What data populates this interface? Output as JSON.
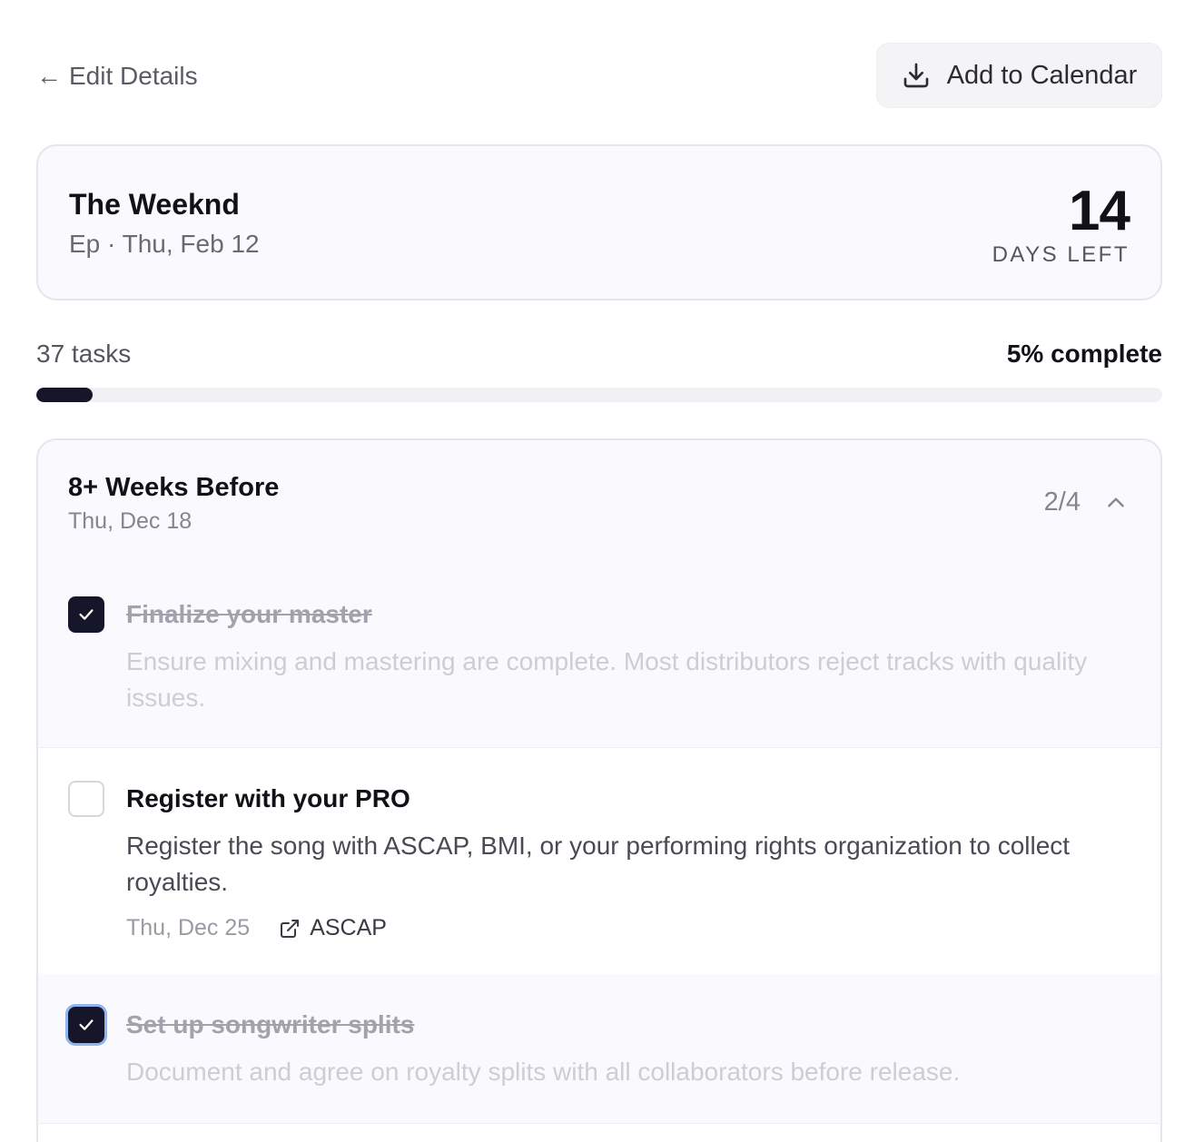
{
  "nav": {
    "back_label": "Edit Details",
    "calendar_button_label": "Add to Calendar"
  },
  "release": {
    "artist": "The Weeknd",
    "subtitle": "Ep · Thu, Feb 12",
    "days_left_value": "14",
    "days_left_label": "DAYS LEFT"
  },
  "progress": {
    "tasks_label": "37 tasks",
    "complete_label": "5% complete",
    "fraction": 0.05
  },
  "section": {
    "title": "8+ Weeks Before",
    "date": "Thu, Dec 18",
    "count": "2/4",
    "tasks": [
      {
        "title": "Finalize your master",
        "description": "Ensure mixing and mastering are complete. Most distributors reject tracks with quality issues.",
        "checked": true
      },
      {
        "title": "Register with your PRO",
        "description": "Register the song with ASCAP, BMI, or your performing rights organization to collect royalties.",
        "due": "Thu, Dec 25",
        "link_label": "ASCAP",
        "checked": false
      },
      {
        "title": "Set up songwriter splits",
        "description": "Document and agree on royalty splits with all collaborators before release.",
        "checked": true
      }
    ]
  },
  "colors": {
    "accent_dark": "#16162a",
    "focus_ring": "#8fb4ee",
    "card_bg": "#faf9fd"
  }
}
